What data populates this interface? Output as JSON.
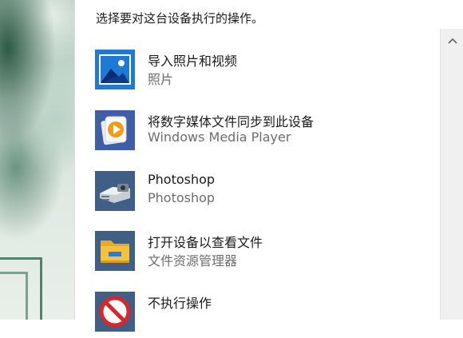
{
  "dialog": {
    "heading": "选择要对这台设备执行的操作。",
    "options": [
      {
        "title": "导入照片和视频",
        "subtitle": "照片",
        "icon": "photos-icon"
      },
      {
        "title": "将数字媒体文件同步到此设备",
        "subtitle": "Windows Media Player",
        "icon": "windows-media-player-icon"
      },
      {
        "title": "Photoshop",
        "subtitle": "Photoshop",
        "icon": "photoshop-scanner-icon"
      },
      {
        "title": "打开设备以查看文件",
        "subtitle": "文件资源管理器",
        "icon": "file-explorer-icon"
      },
      {
        "title": "不执行操作",
        "subtitle": "",
        "icon": "no-action-icon"
      }
    ]
  },
  "scrollbar": {
    "up_icon": "chevron-up-icon"
  },
  "colors": {
    "photos_blue": "#1f7ad6",
    "wmp_blue": "#3e5ea8",
    "explorer_yellow": "#f5c33b",
    "no_action_red": "#d8262d"
  }
}
